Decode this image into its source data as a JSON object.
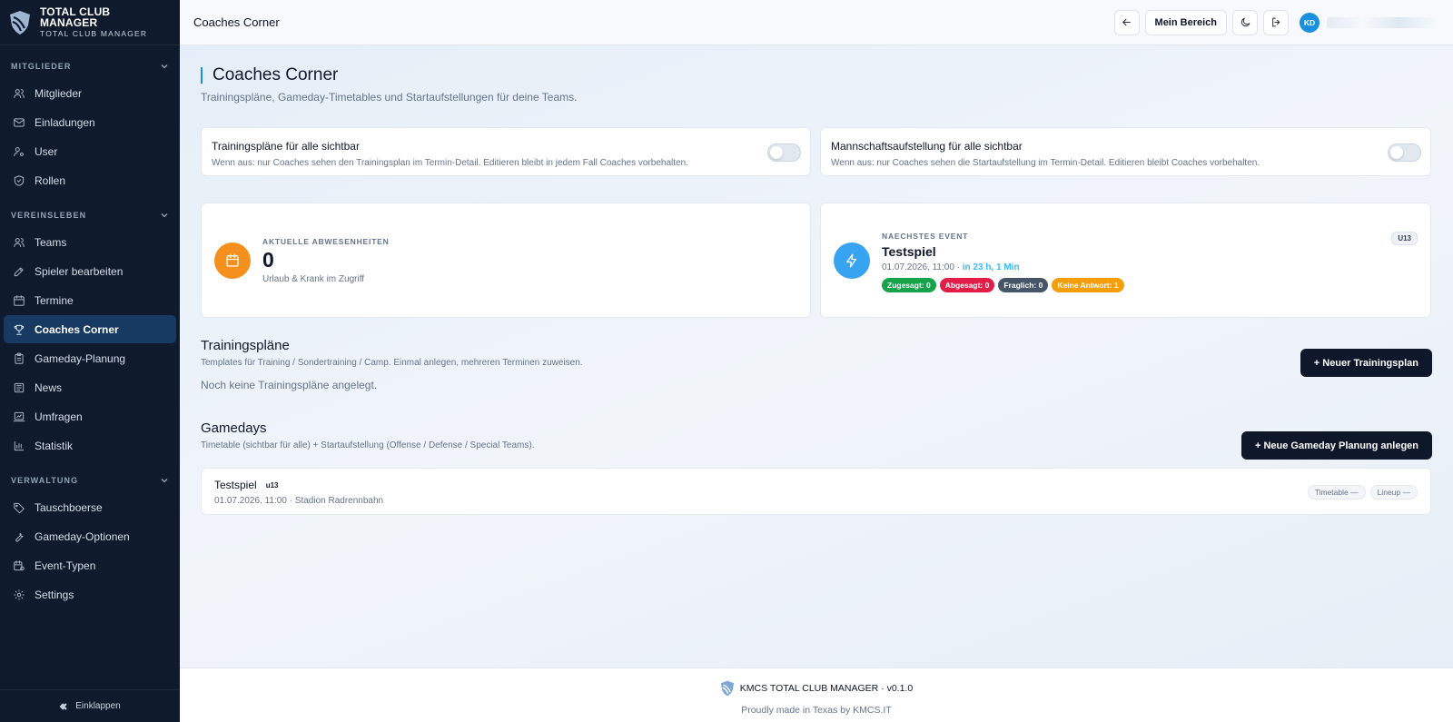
{
  "brand": {
    "title": "TOTAL CLUB MANAGER",
    "subtitle": "TOTAL CLUB MANAGER"
  },
  "sidebar": {
    "sections": [
      {
        "label": "MITGLIEDER",
        "items": [
          "Mitglieder",
          "Einladungen",
          "User",
          "Rollen"
        ]
      },
      {
        "label": "VEREINSLEBEN",
        "items": [
          "Teams",
          "Spieler bearbeiten",
          "Termine",
          "Coaches Corner",
          "Gameday-Planung",
          "News",
          "Umfragen",
          "Statistik"
        ]
      },
      {
        "label": "VERWALTUNG",
        "items": [
          "Tauschboerse",
          "Gameday-Optionen",
          "Event-Typen",
          "Settings"
        ]
      }
    ],
    "collapse_label": "Einklappen"
  },
  "topbar": {
    "title": "Coaches Corner",
    "my_area_label": "Mein Bereich",
    "avatar_initials": "KD"
  },
  "page": {
    "title": "Coaches Corner",
    "subtitle": "Trainingspläne, Gameday-Timetables und Startaufstellungen für deine Teams."
  },
  "toggles": [
    {
      "title": "Trainingspläne für alle sichtbar",
      "desc": "Wenn aus: nur Coaches sehen den Trainingsplan im Termin-Detail. Editieren bleibt in jedem Fall Coaches vorbehalten.",
      "on": false
    },
    {
      "title": "Mannschaftsaufstellung für alle sichtbar",
      "desc": "Wenn aus: nur Coaches sehen die Startaufstellung im Termin-Detail. Editieren bleibt Coaches vorbehalten.",
      "on": false
    }
  ],
  "absences": {
    "label": "AKTUELLE ABWESENHEITEN",
    "value": "0",
    "note": "Urlaub & Krank im Zugriff",
    "icon_color": "#f5901e"
  },
  "next_event": {
    "label": "NAECHSTES EVENT",
    "title": "Testspiel",
    "datetime": "01.07.2026, 11:00",
    "separator": " · ",
    "relative": "in 23 h, 1 Min",
    "team": "U13",
    "icon_color": "#38a3f0",
    "pills": [
      {
        "text": "Zugesagt: 0",
        "color": "#16a34a"
      },
      {
        "text": "Abgesagt: 0",
        "color": "#e11d48"
      },
      {
        "text": "Fraglich: 0",
        "color": "#475569"
      },
      {
        "text": "Keine Antwort: 1",
        "color": "#f59e0b"
      }
    ]
  },
  "training": {
    "title": "Trainingspläne",
    "subtitle": "Templates für Training / Sondertraining / Camp. Einmal anlegen, mehreren Terminen zuweisen.",
    "empty": "Noch keine Trainingspläne angelegt.",
    "new_button": "+ Neuer Trainingsplan"
  },
  "gamedays": {
    "title": "Gamedays",
    "subtitle": "Timetable (sichtbar für alle) + Startaufstellung (Offense / Defense / Special Teams).",
    "new_button": "+ Neue Gameday Planung anlegen",
    "rows": [
      {
        "title": "Testspiel",
        "team": "u13",
        "meta": "01.07.2026, 11:00 · Stadion Radrennbahn",
        "timetable": "Timetable —",
        "lineup": "Lineup —"
      }
    ]
  },
  "footer": {
    "line1": "KMCS TOTAL CLUB MANAGER · v0.1.0",
    "line2": "Proudly made in Texas by KMCS.IT"
  }
}
